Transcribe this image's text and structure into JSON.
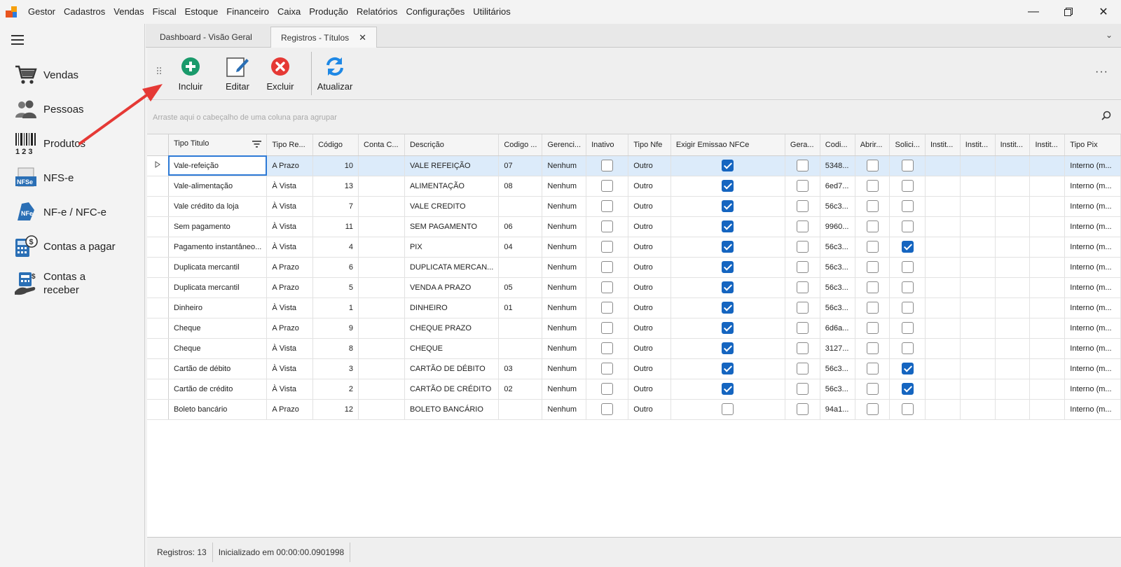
{
  "menu": [
    "Gestor",
    "Cadastros",
    "Vendas",
    "Fiscal",
    "Estoque",
    "Financeiro",
    "Caixa",
    "Produção",
    "Relatórios",
    "Configurações",
    "Utilitários"
  ],
  "sidebar": {
    "items": [
      {
        "label": "Vendas",
        "icon": "cart-icon"
      },
      {
        "label": "Pessoas",
        "icon": "people-icon"
      },
      {
        "label": "Produtos",
        "icon": "barcode-icon"
      },
      {
        "label": "NFS-e",
        "icon": "nfse-icon"
      },
      {
        "label": "NF-e / NFC-e",
        "icon": "nfe-icon"
      },
      {
        "label": "Contas a pagar",
        "icon": "calculator-icon"
      },
      {
        "label": "Contas a receber",
        "icon": "hand-money-icon"
      }
    ]
  },
  "tabs": [
    {
      "label": "Dashboard - Visão Geral",
      "active": false
    },
    {
      "label": "Registros - Títulos",
      "active": true
    }
  ],
  "toolbar": {
    "include": "Incluir",
    "edit": "Editar",
    "delete": "Excluir",
    "refresh": "Atualizar",
    "more": "···"
  },
  "group_panel": {
    "hint": "Arraste aqui o cabeçalho de uma coluna para agrupar"
  },
  "grid": {
    "columns": [
      "Tipo Titulo",
      "Tipo Re...",
      "Código",
      "Conta C...",
      "Descrição",
      "Codigo ...",
      "Gerenci...",
      "Inativo",
      "Tipo Nfe",
      "Exigir Emissao NFCe",
      "Gera...",
      "Codi...",
      "Abrir...",
      "Solici...",
      "Instit...",
      "Instit...",
      "Instit...",
      "Instit...",
      "Tipo Pix"
    ],
    "rows": [
      {
        "tipo": "Vale-refeição",
        "tipo_re": "A Prazo",
        "codigo": "10",
        "conta": "",
        "descricao": "VALE REFEIÇÃO",
        "cod2": "07",
        "gerenci": "Nenhum",
        "inativo": false,
        "tipo_nfe": "Outro",
        "exigir": true,
        "gera": false,
        "codi": "5348...",
        "abrir": false,
        "solici": false,
        "pix": "Interno (m..."
      },
      {
        "tipo": "Vale-alimentação",
        "tipo_re": "À Vista",
        "codigo": "13",
        "conta": "",
        "descricao": "ALIMENTAÇÃO",
        "cod2": "08",
        "gerenci": "Nenhum",
        "inativo": false,
        "tipo_nfe": "Outro",
        "exigir": true,
        "gera": false,
        "codi": "6ed7...",
        "abrir": false,
        "solici": false,
        "pix": "Interno (m..."
      },
      {
        "tipo": "Vale crédito da loja",
        "tipo_re": "À Vista",
        "codigo": "7",
        "conta": "",
        "descricao": "VALE CREDITO",
        "cod2": "",
        "gerenci": "Nenhum",
        "inativo": false,
        "tipo_nfe": "Outro",
        "exigir": true,
        "gera": false,
        "codi": "56c3...",
        "abrir": false,
        "solici": false,
        "pix": "Interno (m..."
      },
      {
        "tipo": "Sem pagamento",
        "tipo_re": "À Vista",
        "codigo": "11",
        "conta": "",
        "descricao": "SEM PAGAMENTO",
        "cod2": "06",
        "gerenci": "Nenhum",
        "inativo": false,
        "tipo_nfe": "Outro",
        "exigir": true,
        "gera": false,
        "codi": "9960...",
        "abrir": false,
        "solici": false,
        "pix": "Interno (m..."
      },
      {
        "tipo": "Pagamento instantâneo...",
        "tipo_re": "À Vista",
        "codigo": "4",
        "conta": "",
        "descricao": "PIX",
        "cod2": "04",
        "gerenci": "Nenhum",
        "inativo": false,
        "tipo_nfe": "Outro",
        "exigir": true,
        "gera": false,
        "codi": "56c3...",
        "abrir": false,
        "solici": true,
        "pix": "Interno (m..."
      },
      {
        "tipo": "Duplicata mercantil",
        "tipo_re": "A Prazo",
        "codigo": "6",
        "conta": "",
        "descricao": "DUPLICATA MERCAN...",
        "cod2": "",
        "gerenci": "Nenhum",
        "inativo": false,
        "tipo_nfe": "Outro",
        "exigir": true,
        "gera": false,
        "codi": "56c3...",
        "abrir": false,
        "solici": false,
        "pix": "Interno (m..."
      },
      {
        "tipo": "Duplicata mercantil",
        "tipo_re": "A Prazo",
        "codigo": "5",
        "conta": "",
        "descricao": "VENDA A PRAZO",
        "cod2": "05",
        "gerenci": "Nenhum",
        "inativo": false,
        "tipo_nfe": "Outro",
        "exigir": true,
        "gera": false,
        "codi": "56c3...",
        "abrir": false,
        "solici": false,
        "pix": "Interno (m..."
      },
      {
        "tipo": "Dinheiro",
        "tipo_re": "À Vista",
        "codigo": "1",
        "conta": "",
        "descricao": "DINHEIRO",
        "cod2": "01",
        "gerenci": "Nenhum",
        "inativo": false,
        "tipo_nfe": "Outro",
        "exigir": true,
        "gera": false,
        "codi": "56c3...",
        "abrir": false,
        "solici": false,
        "pix": "Interno (m..."
      },
      {
        "tipo": "Cheque",
        "tipo_re": "A Prazo",
        "codigo": "9",
        "conta": "",
        "descricao": "CHEQUE PRAZO",
        "cod2": "",
        "gerenci": "Nenhum",
        "inativo": false,
        "tipo_nfe": "Outro",
        "exigir": true,
        "gera": false,
        "codi": "6d6a...",
        "abrir": false,
        "solici": false,
        "pix": "Interno (m..."
      },
      {
        "tipo": "Cheque",
        "tipo_re": "À Vista",
        "codigo": "8",
        "conta": "",
        "descricao": "CHEQUE",
        "cod2": "",
        "gerenci": "Nenhum",
        "inativo": false,
        "tipo_nfe": "Outro",
        "exigir": true,
        "gera": false,
        "codi": "3127...",
        "abrir": false,
        "solici": false,
        "pix": "Interno (m..."
      },
      {
        "tipo": "Cartão de débito",
        "tipo_re": "À Vista",
        "codigo": "3",
        "conta": "",
        "descricao": "CARTÃO DE DÉBITO",
        "cod2": "03",
        "gerenci": "Nenhum",
        "inativo": false,
        "tipo_nfe": "Outro",
        "exigir": true,
        "gera": false,
        "codi": "56c3...",
        "abrir": false,
        "solici": true,
        "pix": "Interno (m..."
      },
      {
        "tipo": "Cartão de crédito",
        "tipo_re": "À Vista",
        "codigo": "2",
        "conta": "",
        "descricao": "CARTÃO DE CRÉDITO",
        "cod2": "02",
        "gerenci": "Nenhum",
        "inativo": false,
        "tipo_nfe": "Outro",
        "exigir": true,
        "gera": false,
        "codi": "56c3...",
        "abrir": false,
        "solici": true,
        "pix": "Interno (m..."
      },
      {
        "tipo": "Boleto bancário",
        "tipo_re": "A Prazo",
        "codigo": "12",
        "conta": "",
        "descricao": "BOLETO BANCÁRIO",
        "cod2": "",
        "gerenci": "Nenhum",
        "inativo": false,
        "tipo_nfe": "Outro",
        "exigir": false,
        "gera": false,
        "codi": "94a1...",
        "abrir": false,
        "solici": false,
        "pix": "Interno (m..."
      }
    ]
  },
  "status": {
    "records": "Registros: 13",
    "init": "Inicializado em 00:00:00.0901998"
  },
  "colors": {
    "accent": "#1565c0",
    "selection": "#dcebfa",
    "arrow": "#e53935"
  }
}
